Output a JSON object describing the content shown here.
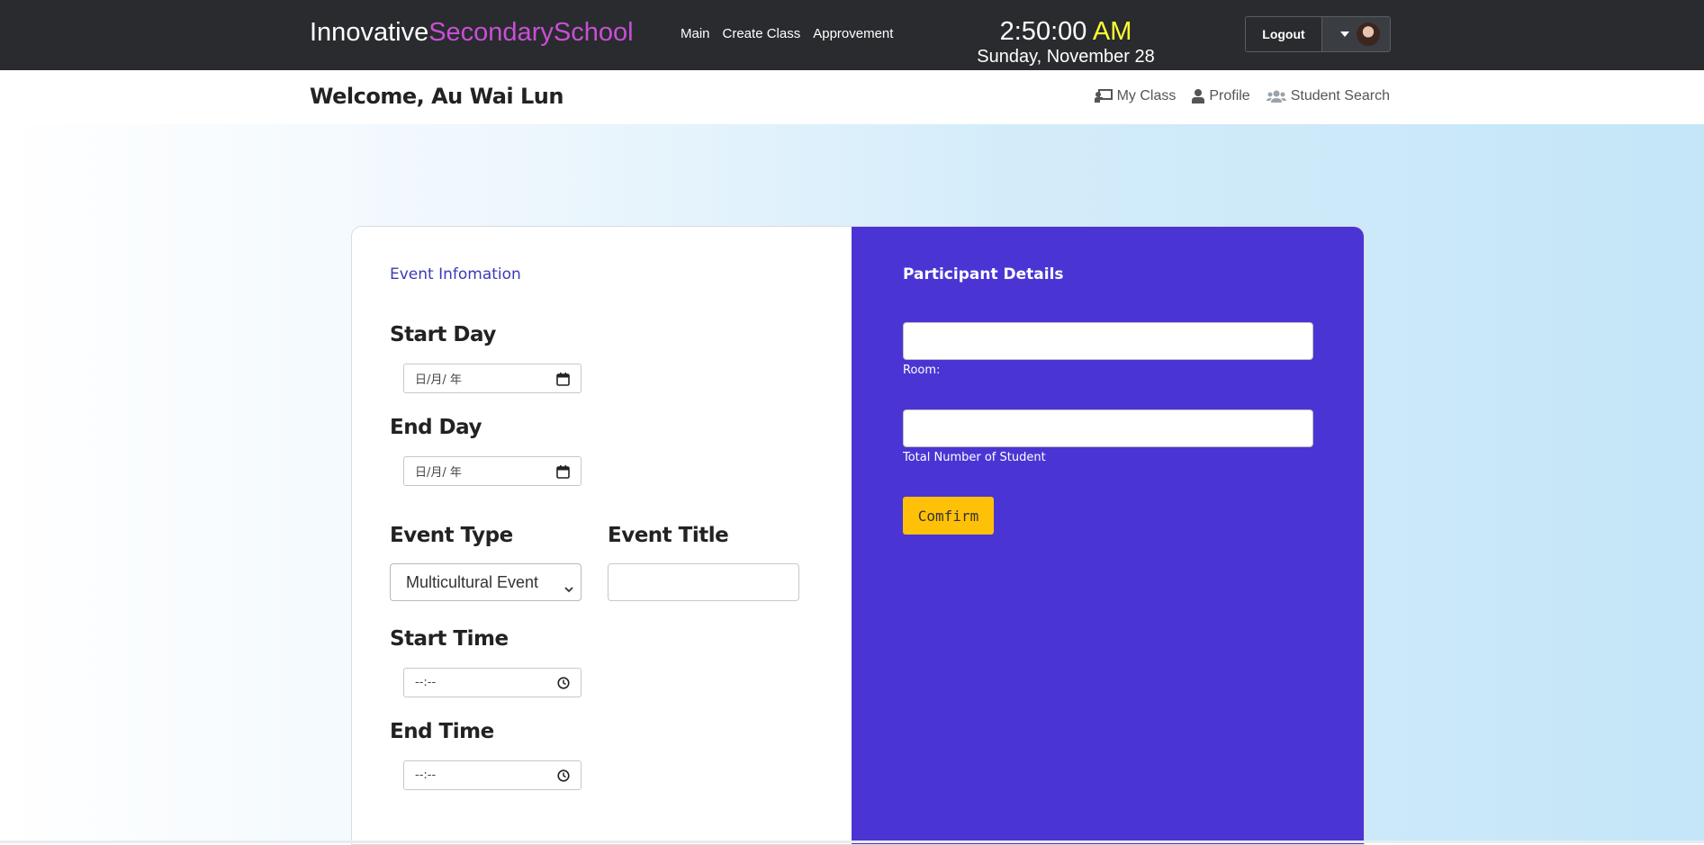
{
  "navbar": {
    "brand_primary": "Innovative",
    "brand_accent": "SecondarySchool",
    "links": [
      {
        "label": "Main"
      },
      {
        "label": "Create Class"
      },
      {
        "label": "Approvement"
      }
    ],
    "clock": {
      "time": "2:50:00",
      "ampm": "AM",
      "date": "Sunday, November 28"
    },
    "logout_label": "Logout",
    "avatar_icon": "user-avatar"
  },
  "subheader": {
    "welcome": "Welcome, Au Wai Lun",
    "links": [
      {
        "label": "My Class",
        "icon": "chalkboard-teacher-icon"
      },
      {
        "label": "Profile",
        "icon": "user-icon"
      },
      {
        "label": "Student Search",
        "icon": "users-icon"
      }
    ]
  },
  "event_info": {
    "title": "Event Infomation",
    "start_day_label": "Start Day",
    "start_day_placeholder": "日/月/ 年",
    "end_day_label": "End Day",
    "end_day_placeholder": "日/月/ 年",
    "event_type_label": "Event Type",
    "event_type_value": "Multicultural Event",
    "event_title_label": "Event Title",
    "event_title_value": "",
    "start_time_label": "Start Time",
    "start_time_placeholder": "--:--",
    "end_time_label": "End Time",
    "end_time_placeholder": "--:--"
  },
  "participant": {
    "title": "Participant Details",
    "room_caption": "Room:",
    "room_value": "",
    "total_caption": "Total Number of Student",
    "total_value": "",
    "confirm_label": "Comfirm"
  },
  "colors": {
    "navbar_bg": "#292b2e",
    "brand_accent": "#c84fd6",
    "ampm": "#ffff33",
    "panel_purple": "#4a35d4",
    "confirm_yellow": "#ffc107",
    "section_title_left": "#3b3bb4"
  }
}
